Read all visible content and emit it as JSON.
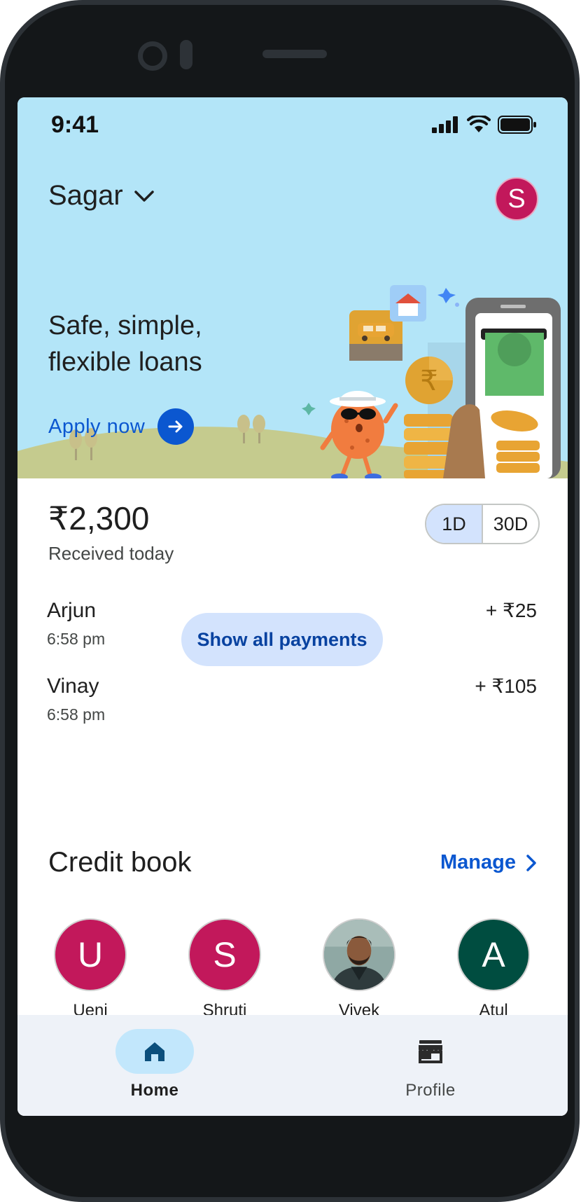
{
  "status_bar": {
    "time": "9:41"
  },
  "header": {
    "account_name": "Sagar",
    "avatar_initial": "S",
    "avatar_color": "#c2185b"
  },
  "promo": {
    "title": "Safe, simple, flexible loans",
    "cta_label": "Apply now"
  },
  "received": {
    "amount": "₹2,300",
    "label": "Received today",
    "ranges": [
      "1D",
      "30D"
    ],
    "selected_range": "1D",
    "show_all_label": "Show all payments",
    "payments": [
      {
        "name": "Arjun",
        "time": "6:58 pm",
        "amount": "+ ₹25"
      },
      {
        "name": "Vinay",
        "time": "6:58 pm",
        "amount": "+ ₹105"
      }
    ]
  },
  "credit_book": {
    "title": "Credit book",
    "manage_label": "Manage",
    "contacts": [
      {
        "initial": "U",
        "name": "Ueni",
        "color": "#c2185b"
      },
      {
        "initial": "S",
        "name": "Shruti",
        "color": "#c2185b"
      },
      {
        "initial": "",
        "name": "Vivek",
        "color": "#5f7d7a"
      },
      {
        "initial": "A",
        "name": "Atul",
        "color": "#004d40"
      }
    ]
  },
  "bottom_nav": {
    "items": [
      {
        "label": "Home",
        "icon": "home-icon",
        "active": true
      },
      {
        "label": "Profile",
        "icon": "storefront-icon",
        "active": false
      }
    ]
  },
  "colors": {
    "accent": "#0b57d0",
    "hero_bg": "#b3e5f8",
    "pill_bg": "#d3e3fd"
  }
}
